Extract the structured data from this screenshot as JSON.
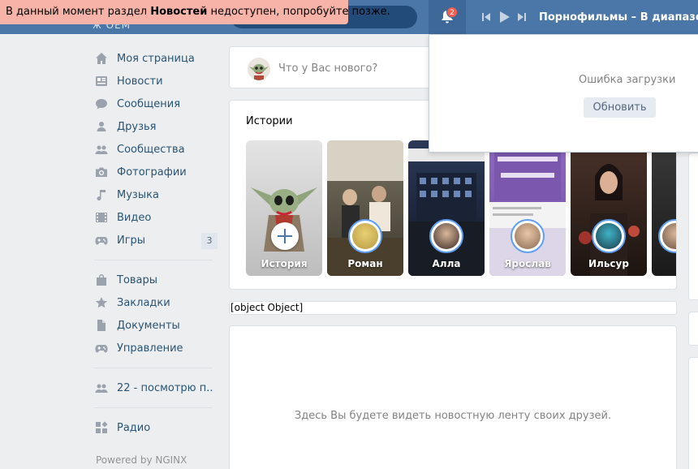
{
  "error_banner": {
    "prefix": "В данный момент раздел ",
    "section": "Новостей",
    "suffix": " недоступен, попробуйте позже."
  },
  "header": {
    "logo_fragment": "ж ОЕМ",
    "notification_count": "2",
    "player": {
      "track": "Порнофильмы – В диапазоне"
    }
  },
  "sidebar": {
    "items": [
      {
        "label": "Моя страница",
        "icon": "home-icon"
      },
      {
        "label": "Новости",
        "icon": "news-icon"
      },
      {
        "label": "Сообщения",
        "icon": "messages-icon"
      },
      {
        "label": "Друзья",
        "icon": "friends-icon"
      },
      {
        "label": "Сообщества",
        "icon": "communities-icon"
      },
      {
        "label": "Фотографии",
        "icon": "camera-icon"
      },
      {
        "label": "Музыка",
        "icon": "music-icon"
      },
      {
        "label": "Видео",
        "icon": "video-icon"
      },
      {
        "label": "Игры",
        "icon": "gamepad-icon",
        "count": "3"
      }
    ],
    "items2": [
      {
        "label": "Товары",
        "icon": "bag-icon"
      },
      {
        "label": "Закладки",
        "icon": "star-icon"
      },
      {
        "label": "Документы",
        "icon": "document-icon"
      },
      {
        "label": "Управление",
        "icon": "gamepad-icon"
      }
    ],
    "items3": [
      {
        "label": "22 - посмотрю п..",
        "icon": "friends-icon"
      }
    ],
    "items4": [
      {
        "label": "Радио",
        "icon": "apps-icon"
      }
    ],
    "powered": "Powered by NGINX"
  },
  "post_box": {
    "placeholder": "Что у Вас нового?"
  },
  "stories": {
    "title": "Истории",
    "items": [
      {
        "name": "История",
        "bg": "#c9c9c9"
      },
      {
        "name": "Роман",
        "bg": "#5c5648"
      },
      {
        "name": "Алла",
        "bg": "#1d2a42"
      },
      {
        "name": "Ярослав",
        "bg": "#8a64b8"
      },
      {
        "name": "Ильсур",
        "bg": "#3a2a24"
      }
    ]
  },
  "object_bar": "[object Object]",
  "feed": {
    "empty_message": "Здесь Вы будете видеть новостную ленту своих друзей."
  },
  "notifications": {
    "error": "Ошибка загрузки",
    "refresh_label": "Обновить"
  },
  "colors": {
    "header": "#4a76a8",
    "accent": "#5f9ef2",
    "banner": "#f8b3a8",
    "link": "#285473"
  }
}
